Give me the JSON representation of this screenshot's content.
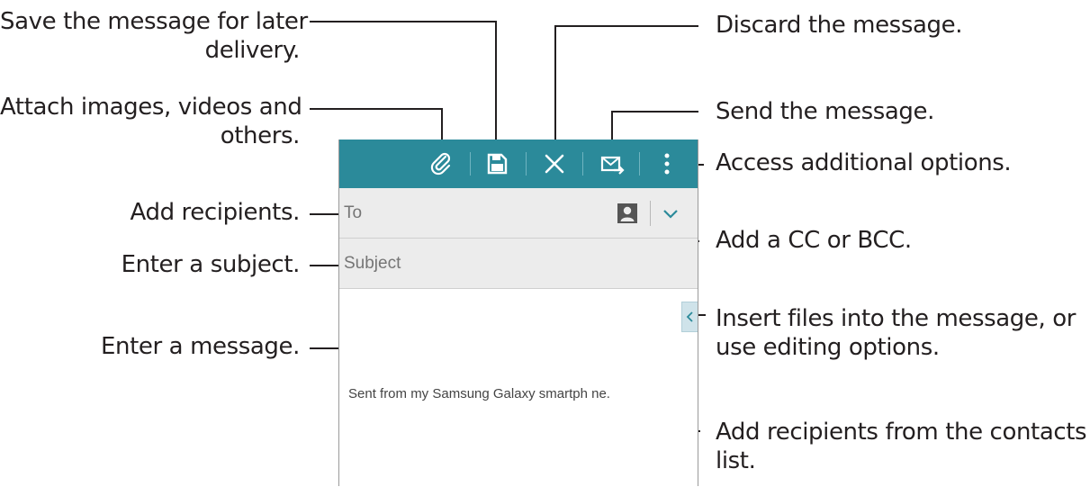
{
  "annotations": {
    "save": [
      "Save the message for later",
      "delivery."
    ],
    "attach": [
      "Attach images, videos and",
      "others."
    ],
    "add_recipients": "Add recipients.",
    "enter_subject": "Enter a subject.",
    "enter_message": "Enter a message.",
    "discard": "Discard the message.",
    "send": "Send the message.",
    "more": "Access additional options.",
    "cc_bcc": "Add a CC or BCC.",
    "insert": [
      "Insert files into the message, or",
      "use editing options."
    ],
    "contacts": [
      "Add recipients from the contacts",
      "list."
    ]
  },
  "compose": {
    "to_placeholder": "To",
    "subject_placeholder": "Subject",
    "signature": "Sent from my Samsung Galaxy smartph ne."
  },
  "colors": {
    "action_bar": "#2b8a9a",
    "field_bg": "#ececec",
    "text": "#231f20"
  },
  "icons": [
    "attach-icon",
    "save-icon",
    "close-icon",
    "send-icon",
    "more-icon",
    "contact-icon",
    "chevron-down-icon",
    "chevron-left-icon"
  ]
}
